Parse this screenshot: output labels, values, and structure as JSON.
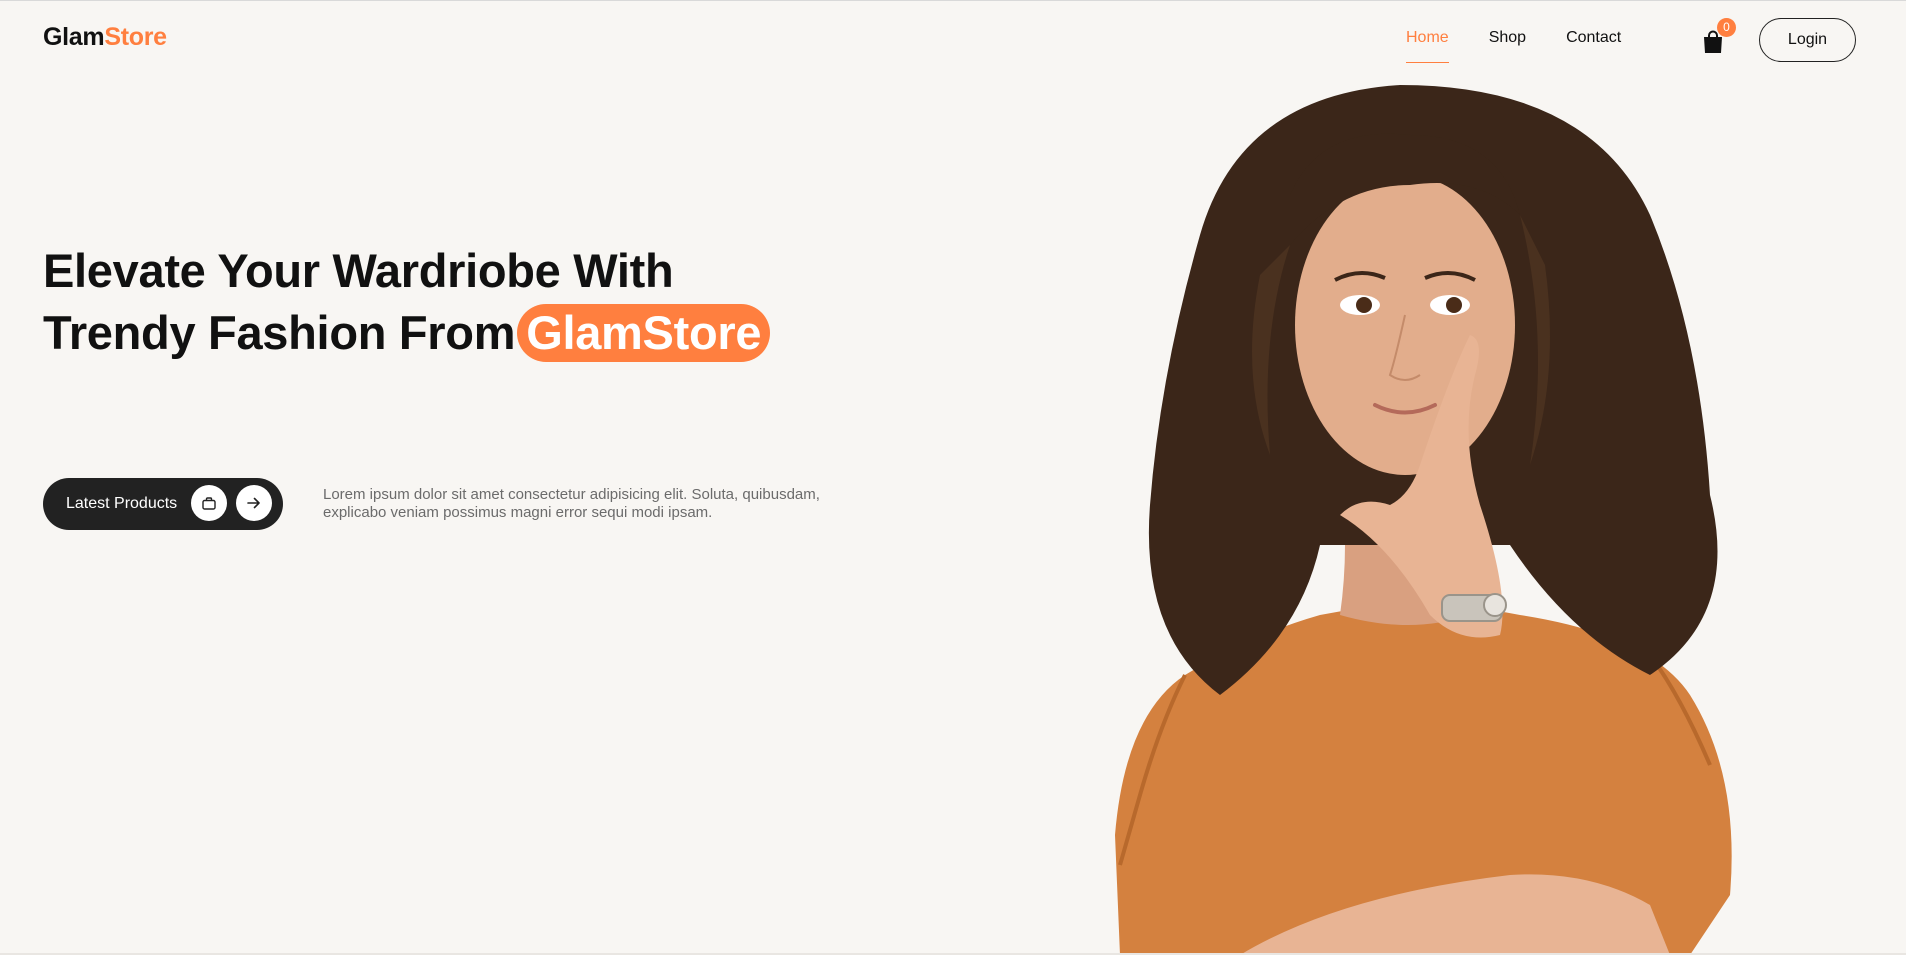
{
  "brand": {
    "part1": "Glam",
    "part2": "Store",
    "accent_color": "#ff7f3f"
  },
  "nav": {
    "links": [
      {
        "label": "Home",
        "active": true
      },
      {
        "label": "Shop",
        "active": false
      },
      {
        "label": "Contact",
        "active": false
      }
    ],
    "cart_count": "0",
    "cart_icon": "shopping-bag-icon",
    "login_label": "Login"
  },
  "hero": {
    "title_line1": "Elevate Your Wardriobe With",
    "title_line2_prefix": "Trendy Fashion From",
    "title_highlight": "GlamStore",
    "cta_label": "Latest Products",
    "cta_icons": [
      "briefcase-icon",
      "arrow-right-icon"
    ],
    "description": "Lorem ipsum dolor sit amet consectetur adipisicing elit. Soluta, quibusdam, explicabo veniam possimus magni error sequi modi ipsam."
  }
}
